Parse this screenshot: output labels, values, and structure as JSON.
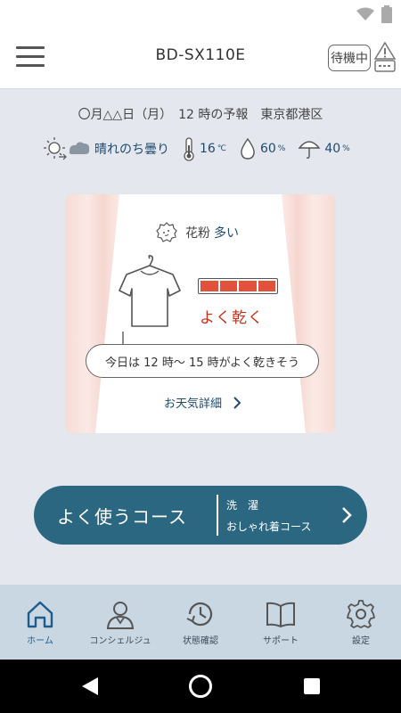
{
  "header": {
    "model": "BD-SX110E",
    "standby_label": "待機中"
  },
  "forecast": {
    "heading": "〇月△△日（月）　12 時の予報　東京都港区",
    "condition": "晴れのち曇り",
    "temperature": "16",
    "temperature_unit": "℃",
    "humidity": "60",
    "humidity_unit": "%",
    "rain_chance": "40",
    "rain_unit": "%"
  },
  "card": {
    "pollen_label": "花粉",
    "pollen_value": "多い",
    "drying_level": {
      "value": 4,
      "max": 4
    },
    "drying_text": "よく乾く",
    "bubble_text": "今日は 12 時〜 15 時がよく乾きそう",
    "detail_link": "お天気詳細"
  },
  "course_button": {
    "label": "よく使うコース",
    "sub1": "洗　濯",
    "sub2": "おしゃれ着コース"
  },
  "bottom_nav": [
    {
      "label": "ホーム",
      "icon": "home-icon",
      "active": true
    },
    {
      "label": "コンシェルジュ",
      "icon": "concierge-icon",
      "active": false
    },
    {
      "label": "状態確認",
      "icon": "status-clock-icon",
      "active": false
    },
    {
      "label": "サポート",
      "icon": "book-icon",
      "active": false
    },
    {
      "label": "設定",
      "icon": "gear-icon",
      "active": false
    }
  ],
  "colors": {
    "accent": "#2c6781",
    "drying_red": "#c8321d",
    "nav_bg": "#c9d7e3",
    "text_blue": "#1f4a6e"
  }
}
